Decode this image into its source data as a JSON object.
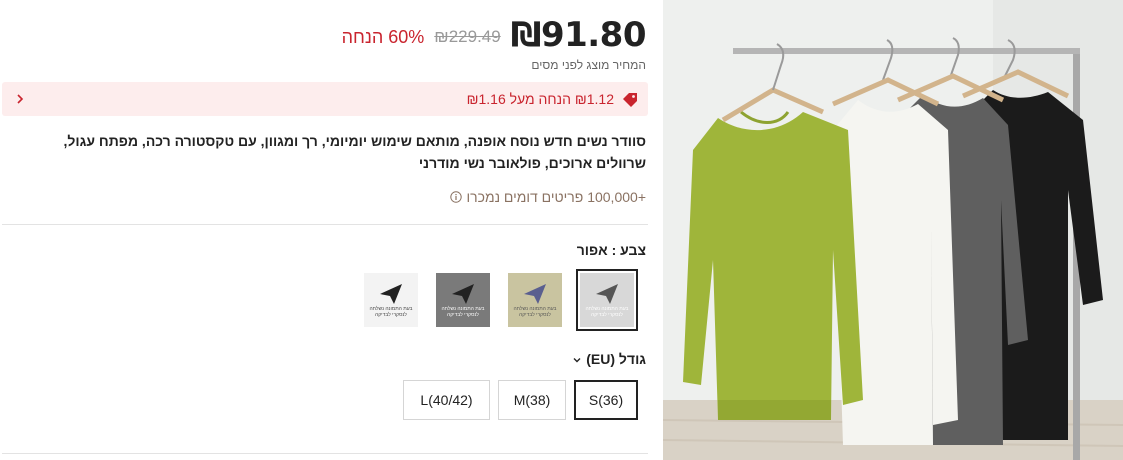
{
  "price": {
    "current": "₪91.80",
    "original": "₪229.49",
    "discount": "60% הנחה",
    "note": "המחיר מוצג לפני מסים"
  },
  "coupon": {
    "text": "₪1.12 הנחה מעל ₪1.16"
  },
  "product": {
    "title": "סוודר נשים חדש נוסח אופנה, מותאם שימוש יומיומי, רך ומגוון, עם טקסטורה רכה, מפתח עגול, שרוולים ארוכים, פולאובר נשי מודרני",
    "sold": "+100,000 פריטים דומים נמכרו"
  },
  "color": {
    "label": "צבע : אפור",
    "swatches": [
      {
        "name": "gray",
        "bg": "#d8d8d8",
        "caption": "בעת התמונה נשלחה לנסקרי לבדיקה"
      },
      {
        "name": "khaki",
        "bg": "#c9c4a0",
        "caption": "בעת התמונה נשלחה לנסקרי לבדיקה"
      },
      {
        "name": "dark-gray",
        "bg": "#7a7a7a",
        "caption": "בעת התמונה נשלחה לנסקרי לבדיקה"
      },
      {
        "name": "white",
        "bg": "#f3f3f3",
        "caption": "בעת התמונה נשלחה לנסקרי לבדיקה"
      }
    ]
  },
  "size": {
    "label": "גודל (EU)",
    "options": [
      "S(36)",
      "M(38)",
      "L(40/42)"
    ],
    "selected": "S(36)"
  },
  "colors": {
    "accent_red": "#c9242e",
    "coupon_bg": "#fdeded",
    "sweater_green": "#9fb53a",
    "sweater_white": "#f4f4f0",
    "sweater_gray": "#5e5e5e",
    "sweater_black": "#1a1a1a"
  }
}
